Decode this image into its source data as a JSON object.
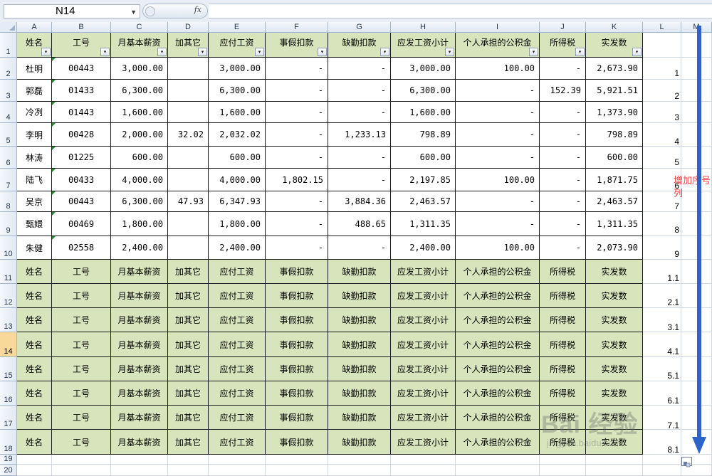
{
  "formula_bar": {
    "cell_ref": "N14",
    "fx_label": "fx",
    "formula": ""
  },
  "columns": [
    "A",
    "B",
    "C",
    "D",
    "E",
    "F",
    "G",
    "H",
    "I",
    "J",
    "K",
    "L",
    "M"
  ],
  "rows": [
    "1",
    "2",
    "3",
    "4",
    "5",
    "6",
    "7",
    "8",
    "9",
    "10",
    "11",
    "12",
    "13",
    "14",
    "15",
    "16",
    "17",
    "18",
    "19",
    "20"
  ],
  "active_row": "14",
  "headers": [
    "姓名",
    "工号",
    "月基本薪资",
    "加其它",
    "应付工资",
    "事假扣款",
    "缺勤扣款",
    "应发工资小计",
    "个人承担的公积金",
    "所得税",
    "实发数"
  ],
  "data_rows": [
    [
      "杜明",
      "00443",
      "3,000.00",
      "",
      "3,000.00",
      "-",
      "-",
      "3,000.00",
      "100.00",
      "-",
      "2,673.90"
    ],
    [
      "郭磊",
      "01433",
      "6,300.00",
      "",
      "6,300.00",
      "-",
      "-",
      "6,300.00",
      "-",
      "152.39",
      "5,921.51"
    ],
    [
      "冷冽",
      "01443",
      "1,600.00",
      "",
      "1,600.00",
      "-",
      "-",
      "1,600.00",
      "-",
      "-",
      "1,373.90"
    ],
    [
      "李明",
      "00428",
      "2,000.00",
      "32.02",
      "2,032.02",
      "-",
      "1,233.13",
      "798.89",
      "-",
      "-",
      "798.89"
    ],
    [
      "林涛",
      "01225",
      "600.00",
      "",
      "600.00",
      "-",
      "-",
      "600.00",
      "-",
      "-",
      "600.00"
    ],
    [
      "陆飞",
      "00433",
      "4,000.00",
      "",
      "4,000.00",
      "1,802.15",
      "-",
      "2,197.85",
      "100.00",
      "-",
      "1,871.75"
    ],
    [
      "吴京",
      "00443",
      "6,300.00",
      "47.93",
      "6,347.93",
      "-",
      "3,884.36",
      "2,463.57",
      "-",
      "-",
      "2,463.57"
    ],
    [
      "甄嬛",
      "00469",
      "1,800.00",
      "",
      "1,800.00",
      "-",
      "488.65",
      "1,311.35",
      "-",
      "-",
      "1,311.35"
    ],
    [
      "朱健",
      "02558",
      "2,400.00",
      "",
      "2,400.00",
      "-",
      "-",
      "2,400.00",
      "100.00",
      "-",
      "2,073.90"
    ]
  ],
  "sequence": [
    "1",
    "2",
    "3",
    "4",
    "5",
    "6",
    "7",
    "8",
    "9",
    "1.1",
    "2.1",
    "3.1",
    "4.1",
    "5.1",
    "6.1",
    "7.1",
    "8.1"
  ],
  "annotation": "增加序号列",
  "watermark": {
    "main": "Bai 经验",
    "sub": "jingyan.baidu.com"
  },
  "colors": {
    "header_fill": "#d8e4bc",
    "grid": "#d0d7e5",
    "arrow": "#2e63c9",
    "annotation": "#ff3c3c",
    "active_row": "#f9d99a"
  }
}
